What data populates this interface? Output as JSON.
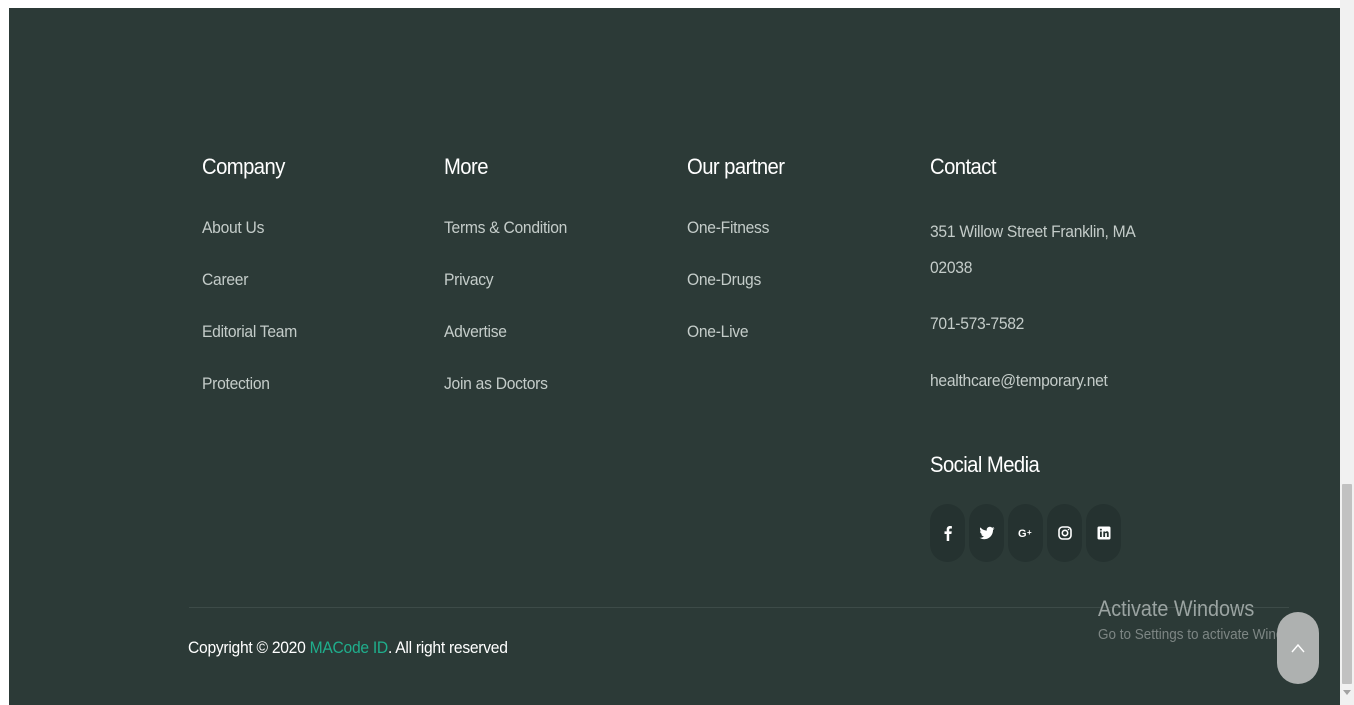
{
  "columns": {
    "company": {
      "title": "Company",
      "items": [
        "About Us",
        "Career",
        "Editorial Team",
        "Protection"
      ]
    },
    "more": {
      "title": "More",
      "items": [
        "Terms & Condition",
        "Privacy",
        "Advertise",
        "Join as Doctors"
      ]
    },
    "partner": {
      "title": "Our partner",
      "items": [
        "One-Fitness",
        "One-Drugs",
        "One-Live"
      ]
    },
    "contact": {
      "title": "Contact",
      "address_line1": "351 Willow Street Franklin, MA",
      "address_line2": "02038",
      "phone": "701-573-7582",
      "email": "healthcare@temporary.net"
    }
  },
  "social": {
    "title": "Social Media",
    "icons": [
      "facebook-icon",
      "twitter-icon",
      "google-plus-icon",
      "instagram-icon",
      "linkedin-icon"
    ]
  },
  "copyright": {
    "prefix": "Copyright © 2020 ",
    "brand": "MACode ID",
    "suffix": ". All right reserved"
  },
  "activation": {
    "title": "Activate Windows",
    "subtitle": "Go to Settings to activate Windows."
  },
  "colors": {
    "background": "#2c3a37",
    "brand": "#1fae8c",
    "link": "#c4ccc9"
  }
}
